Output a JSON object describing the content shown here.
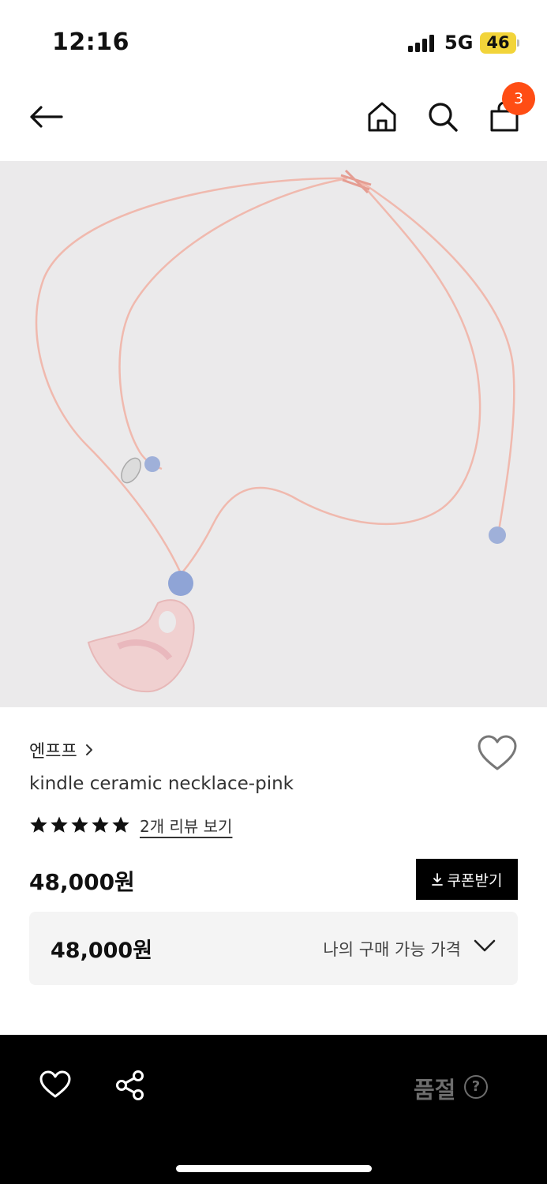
{
  "status_bar": {
    "time": "12:16",
    "network": "5G",
    "battery": "46"
  },
  "nav": {
    "cart_count": "3",
    "icons": [
      "back-arrow-icon",
      "home-icon",
      "search-icon",
      "shopping-bag-icon"
    ]
  },
  "product": {
    "brand": "엔프프",
    "name": "kindle ceramic necklace-pink",
    "rating_stars": 5,
    "review_link": "2개 리뷰 보기",
    "price": "48,000원",
    "coupon_button": "쿠폰받기",
    "my_price": {
      "value": "48,000원",
      "label": "나의 구매 가능 가격"
    }
  },
  "bottom_bar": {
    "soldout_label": "품절",
    "help_symbol": "?"
  },
  "colors": {
    "badge": "#ff4d14",
    "battery": "#f2d43a",
    "image_bg": "#ebeaeb",
    "bottom_bar": "#000000",
    "soldout": "#6d6d6d"
  }
}
